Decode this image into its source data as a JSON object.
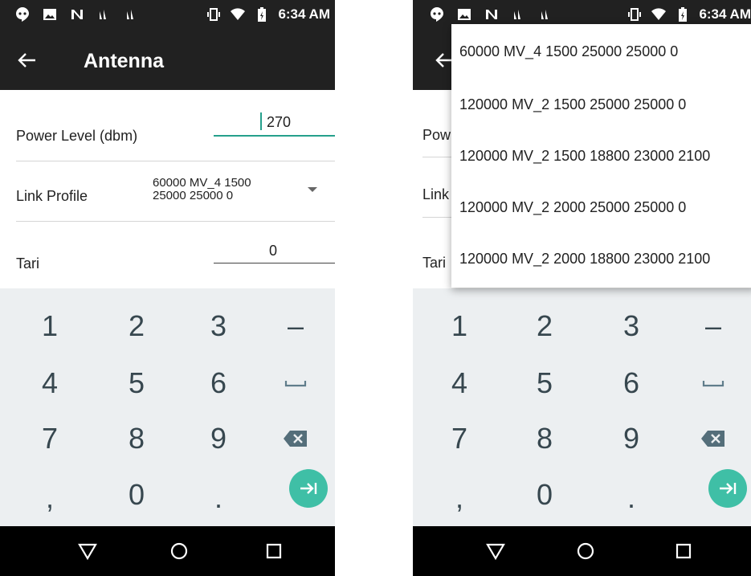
{
  "status_bar": {
    "time": "6:34 AM"
  },
  "app_bar": {
    "title": "Antenna"
  },
  "form": {
    "power_level": {
      "label": "Power Level (dbm)",
      "value": "270"
    },
    "link_profile": {
      "label": "Link Profile",
      "value": "60000 MV_4 1500 25000 25000 0"
    },
    "tari": {
      "label": "Tari",
      "value": "0"
    }
  },
  "right_form_labels": {
    "power": "Pow",
    "link": "Link",
    "tari": "Tari"
  },
  "dropdown_options": [
    "60000 MV_4 1500 25000 25000 0",
    "120000 MV_2 1500 25000 25000 0",
    "120000 MV_2 1500 18800 23000 2100",
    "120000 MV_2 2000 25000 25000 0",
    "120000 MV_2 2000 18800 23000 2100"
  ],
  "keypad": {
    "k1": "1",
    "k2": "2",
    "k3": "3",
    "minus": "–",
    "k4": "4",
    "k5": "5",
    "k6": "6",
    "k7": "7",
    "k8": "8",
    "k9": "9",
    "comma": ",",
    "k0": "0",
    "period": "."
  },
  "colors": {
    "accent": "#25a08c",
    "bar": "#212121",
    "keyboard_bg": "#eceff1",
    "enter": "#3fbfa6"
  },
  "icons": [
    "hangouts-icon",
    "image-icon",
    "n-icon",
    "signal-icon",
    "vibrate-icon",
    "wifi-icon",
    "battery-icon",
    "back-arrow-icon",
    "space-icon",
    "backspace-icon",
    "next-icon",
    "nav-back-icon",
    "nav-home-icon",
    "nav-recents-icon"
  ]
}
